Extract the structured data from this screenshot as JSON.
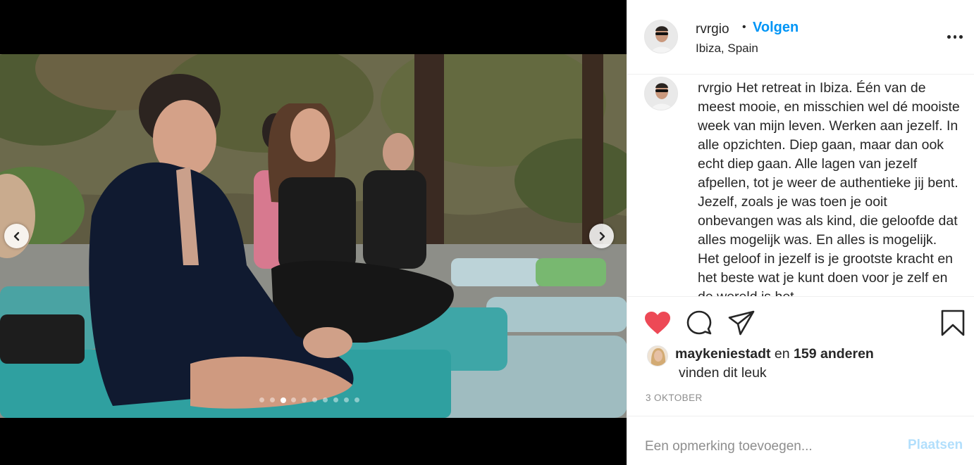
{
  "media": {
    "carousel": {
      "total_slides": 10,
      "active_index": 2
    },
    "prev_icon": "chevron-left-icon",
    "next_icon": "chevron-right-icon"
  },
  "header": {
    "username": "rvrgio",
    "separator": "•",
    "follow_label": "Volgen",
    "location": "Ibiza, Spain",
    "more_icon": "more-options-icon"
  },
  "caption": {
    "username": "rvrgio",
    "text": "Het retreat in Ibiza. Één van de meest mooie, en misschien wel dé mooiste week van mijn leven. Werken aan jezelf. In alle opzichten. Diep gaan, maar dan ook echt diep gaan. Alle lagen van jezelf afpellen, tot je weer de authentieke jij bent. Jezelf, zoals je was toen je ooit onbevangen was als kind, die geloofde dat alles mogelijk was. En alles is mogelijk. Het geloof in jezelf is je grootste kracht en het beste wat je kunt doen voor je zelf en de wereld is het"
  },
  "actions": {
    "liked": true,
    "like_icon": "heart-icon",
    "comment_icon": "comment-icon",
    "share_icon": "share-icon",
    "save_icon": "bookmark-icon",
    "like_color": "#ed4956"
  },
  "likes": {
    "first_liker": "maykeniestadt",
    "connector": "en",
    "others": "159 anderen",
    "suffix": "vinden dit leuk"
  },
  "date": "3 OKTOBER",
  "comment": {
    "placeholder": "Een opmerking toevoegen...",
    "post_label": "Plaatsen"
  },
  "colors": {
    "accent": "#0095f6",
    "disabled_accent": "#b2dffc",
    "muted_text": "#8e8e8e"
  }
}
